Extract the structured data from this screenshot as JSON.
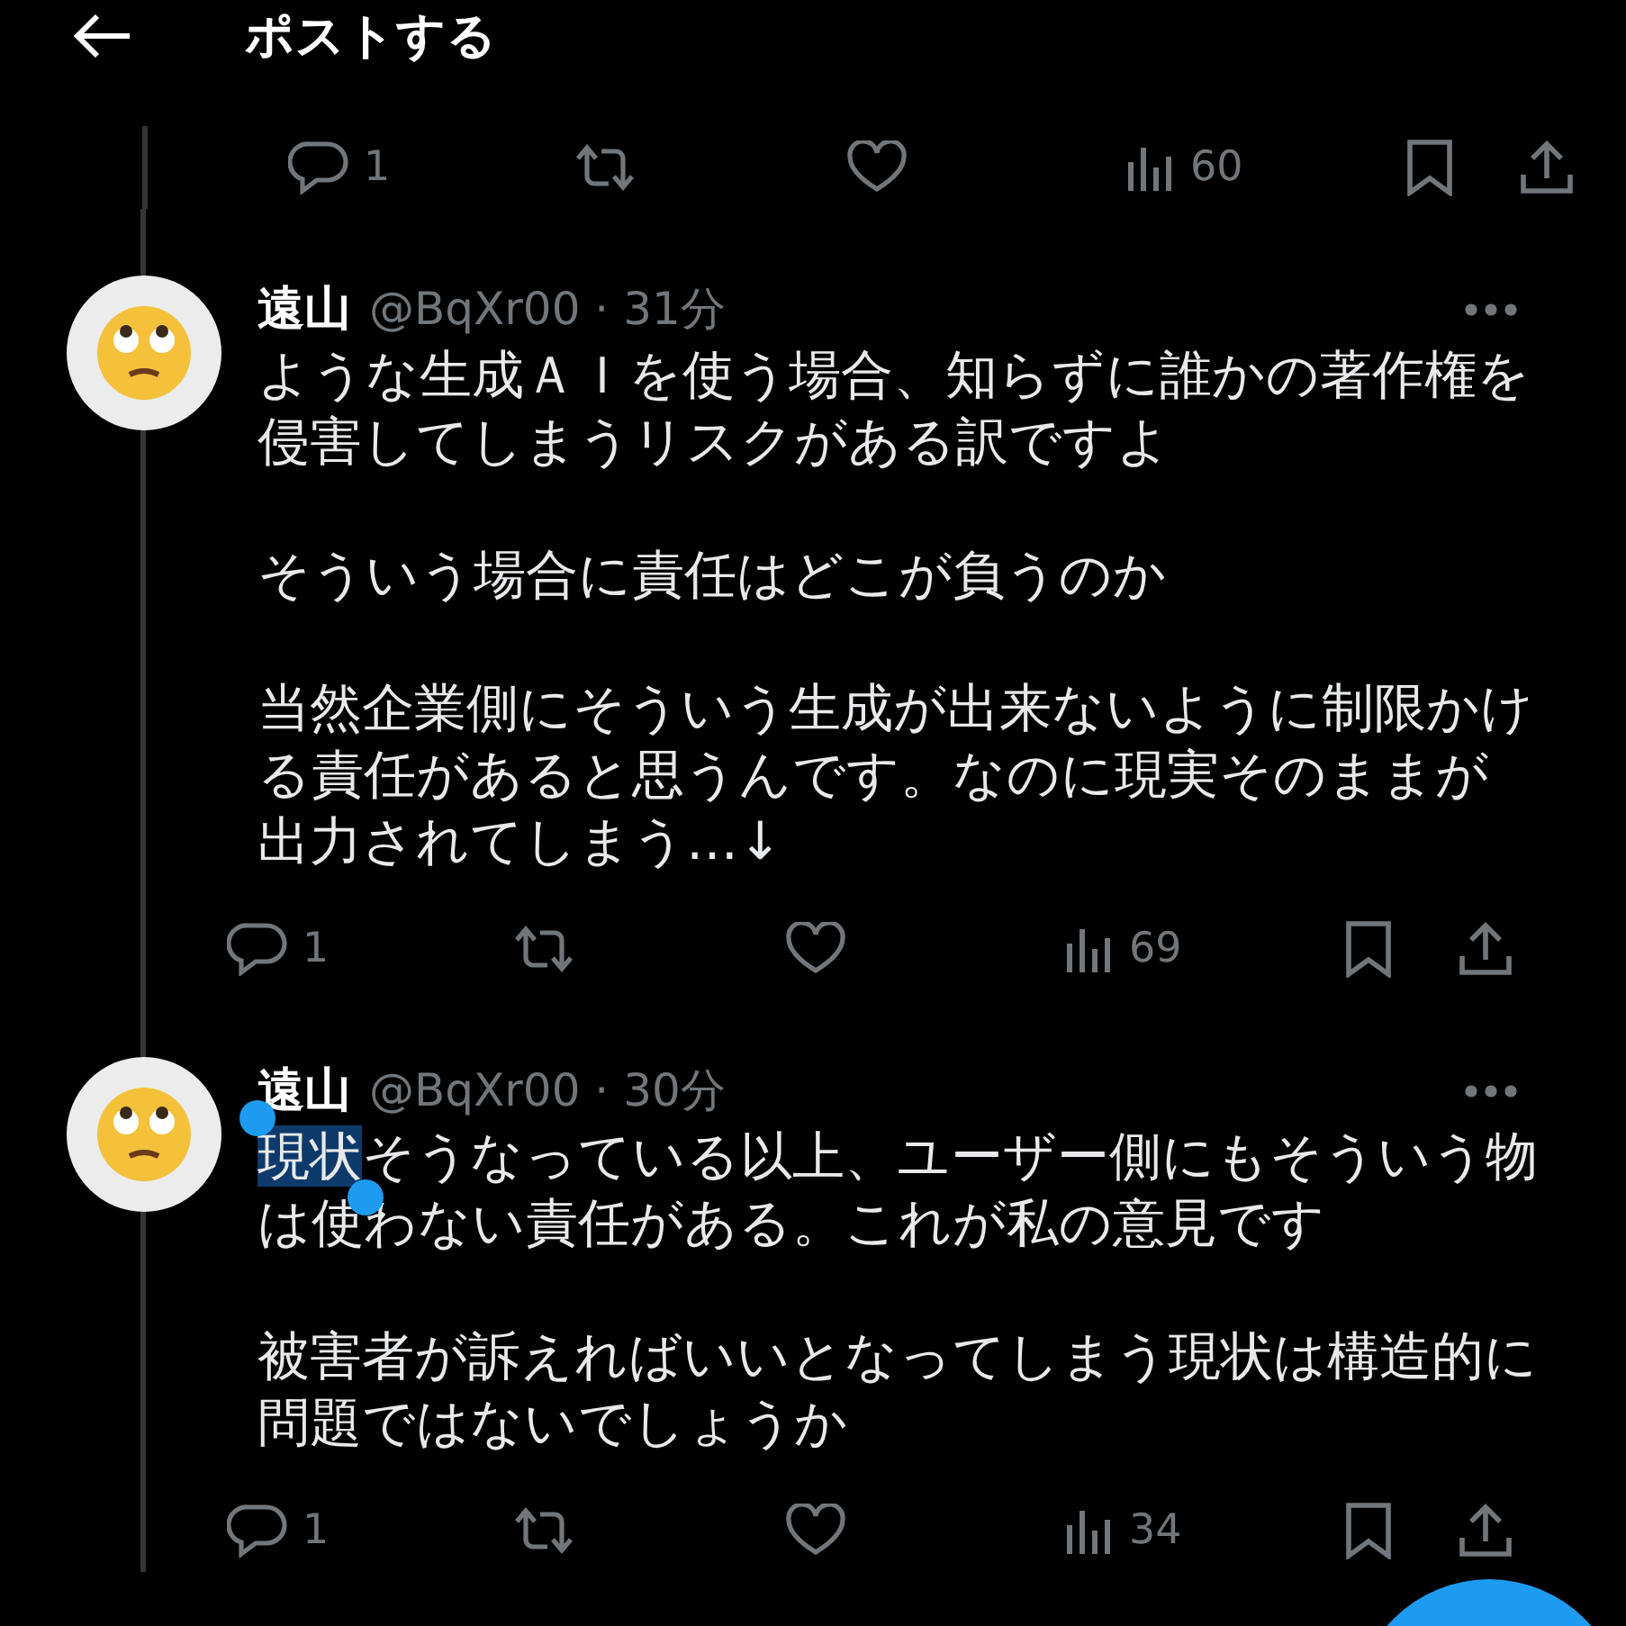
{
  "header": {
    "title": "ポストする"
  },
  "top_actions": {
    "replies": "1",
    "views": "60"
  },
  "posts": [
    {
      "name": "遠山",
      "meta": "@BqXr00 · 31分",
      "paragraphs": [
        [
          {
            "text": "ような生成ＡＩを使う場合、知らずに誰かの著作権を侵害してしまうリスクがある訳ですよ",
            "selected": false
          }
        ],
        [
          {
            "text": "そういう場合に責任はどこが負うのか",
            "selected": false
          }
        ],
        [
          {
            "text": "当然企業側にそういう生成が出来ないように制限かける責任があると思うんです。なのに現実そのままが出力されてしまう…↓",
            "selected": false
          }
        ]
      ],
      "actions": {
        "replies": "1",
        "views": "69"
      }
    },
    {
      "name": "遠山",
      "meta": "@BqXr00 · 30分",
      "paragraphs": [
        [
          {
            "text": "現状",
            "selected": true
          },
          {
            "text": "そうなっている以上、ユーザー側にもそういう物は使わない責任がある。これが私の意見です",
            "selected": false
          }
        ],
        [
          {
            "text": "被害者が訴えればいいとなってしまう現状は構造的に問題ではないでしょうか",
            "selected": false
          }
        ]
      ],
      "actions": {
        "replies": "1",
        "views": "34"
      }
    }
  ]
}
